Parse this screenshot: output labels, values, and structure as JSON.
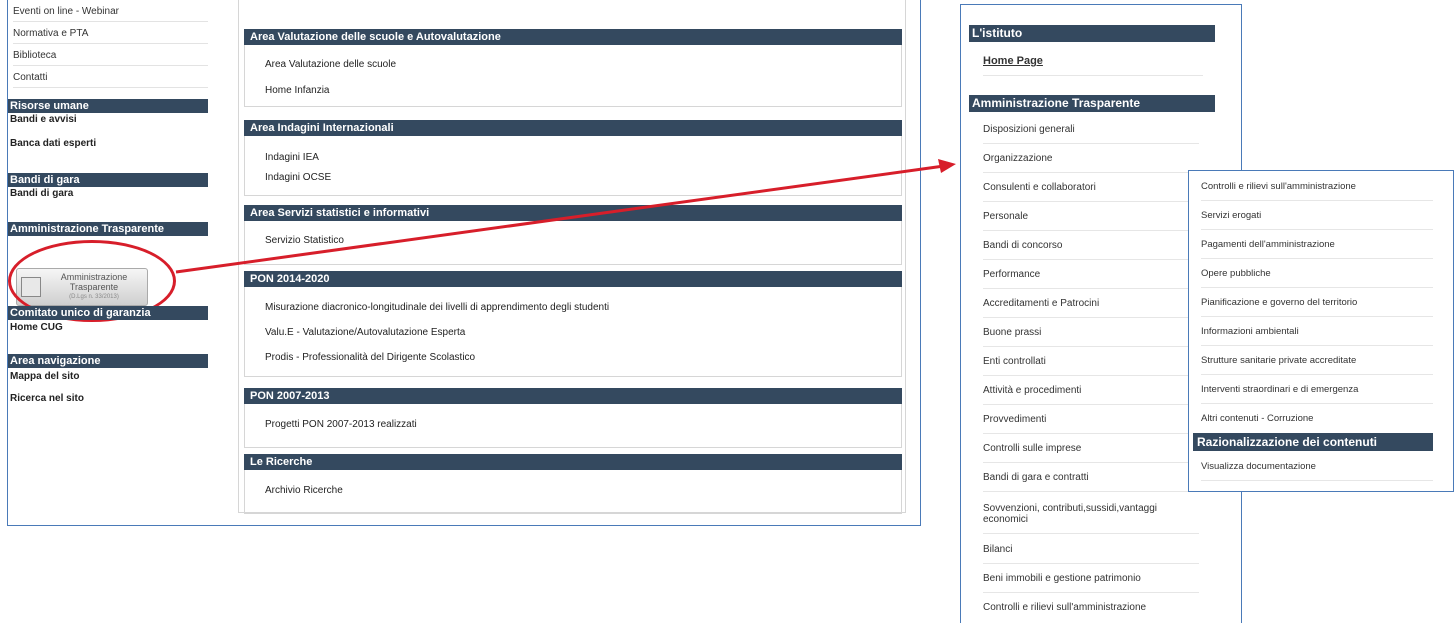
{
  "left": {
    "sidebar": {
      "top_links": [
        "Eventi on line - Webinar",
        "Normativa e PTA",
        "Biblioteca",
        "Contatti"
      ],
      "sections": [
        {
          "title": "Risorse umane",
          "items": [
            "Bandi e avvisi",
            "Banca dati esperti"
          ]
        },
        {
          "title": "Bandi di gara",
          "items": [
            "Bandi di gara"
          ]
        },
        {
          "title": "Amministrazione Trasparente",
          "items": []
        },
        {
          "title": "Comitato unico di garanzia",
          "items": [
            "Home CUG"
          ]
        },
        {
          "title": "Area navigazione",
          "items": [
            "Mappa del sito",
            "Ricerca nel sito"
          ]
        }
      ],
      "logo": {
        "line1": "Amministrazione",
        "line2": "Trasparente",
        "line3": "(D.Lgs n. 33/2013)"
      }
    },
    "content": [
      {
        "title": "Area Valutazione delle scuole e Autovalutazione",
        "links": [
          "Area Valutazione delle scuole",
          "Home Infanzia"
        ]
      },
      {
        "title": "Area Indagini Internazionali",
        "links": [
          "Indagini IEA",
          "Indagini OCSE"
        ]
      },
      {
        "title": "Area Servizi statistici e informativi",
        "links": [
          "Servizio Statistico"
        ]
      },
      {
        "title": "PON 2014-2020",
        "links": [
          "Misurazione diacronico-longitudinale dei livelli di apprendimento degli studenti",
          "Valu.E - Valutazione/Autovalutazione Esperta",
          "Prodis - Professionalità del Dirigente Scolastico"
        ]
      },
      {
        "title": "PON 2007-2013",
        "links": [
          "Progetti PON 2007-2013 realizzati"
        ]
      },
      {
        "title": "Le Ricerche",
        "links": [
          "Archivio Ricerche"
        ]
      }
    ]
  },
  "right": {
    "istituto_title": "L'istituto",
    "home_page": "Home Page",
    "at_title": "Amministrazione Trasparente",
    "items": [
      "Disposizioni generali",
      "Organizzazione",
      "Consulenti e collaboratori",
      "Personale",
      "Bandi di concorso",
      "Performance",
      "Accreditamenti e Patrocini",
      "Buone prassi",
      "Enti controllati",
      "Attività e procedimenti",
      "Provvedimenti",
      "Controlli sulle imprese",
      "Bandi di gara e contratti",
      "Sovvenzioni, contributi,sussidi,vantaggi economici",
      "Bilanci",
      "Beni immobili e gestione patrimonio",
      "Controlli e rilievi sull'amministrazione"
    ]
  },
  "popup": {
    "items": [
      "Controlli e rilievi sull'amministrazione",
      "Servizi erogati",
      "Pagamenti dell'amministrazione",
      "Opere pubbliche",
      "Pianificazione e governo del territorio",
      "Informazioni ambientali",
      "Strutture sanitarie private accreditate",
      "Interventi straordinari e di emergenza",
      "Altri contenuti - Corruzione"
    ],
    "section_title": "Razionalizzazione dei contenuti",
    "section_item": "Visualizza documentazione"
  },
  "colors": {
    "header": "#34495f",
    "border": "#4a7ab8",
    "highlight": "#d71e2a"
  }
}
